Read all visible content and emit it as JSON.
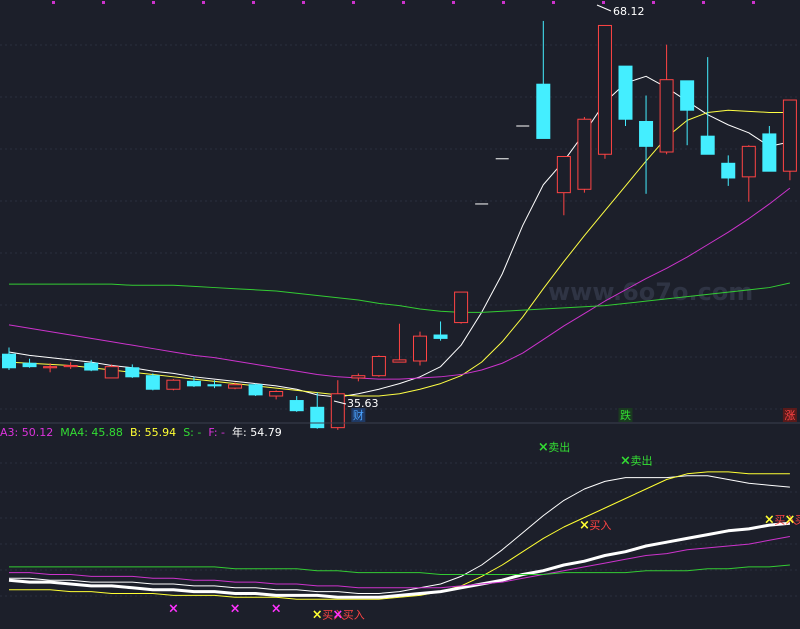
{
  "chart_data": [
    {
      "type": "candlestick",
      "panel": "price",
      "grid": true,
      "ylim": [
        33,
        70
      ],
      "annotations": {
        "high_label": "68.12",
        "low_label": "35.63",
        "watermark": "www.6o7o.com"
      },
      "markers": [
        {
          "x": 17,
          "label": "财",
          "color": "#4aa3ff",
          "bg": "#1f3a66"
        },
        {
          "x": 30,
          "label": "跌",
          "color": "#33dd33",
          "bg": "#1a3a20"
        },
        {
          "x": 38,
          "label": "涨",
          "color": "#ff4444",
          "bg": "#5a1a1a"
        }
      ],
      "candles": [
        {
          "o": 39.0,
          "h": 39.6,
          "l": 37.6,
          "c": 37.8
        },
        {
          "o": 38.2,
          "h": 38.6,
          "l": 37.8,
          "c": 37.9
        },
        {
          "o": 37.8,
          "h": 38.2,
          "l": 37.4,
          "c": 37.9
        },
        {
          "o": 37.9,
          "h": 38.3,
          "l": 37.7,
          "c": 38.0
        },
        {
          "o": 38.2,
          "h": 38.5,
          "l": 37.5,
          "c": 37.6
        },
        {
          "o": 36.9,
          "h": 38.1,
          "l": 36.9,
          "c": 37.9
        },
        {
          "o": 37.8,
          "h": 38.1,
          "l": 36.9,
          "c": 37.0
        },
        {
          "o": 37.1,
          "h": 37.3,
          "l": 35.8,
          "c": 35.9
        },
        {
          "o": 35.9,
          "h": 36.8,
          "l": 35.8,
          "c": 36.7
        },
        {
          "o": 36.6,
          "h": 37.0,
          "l": 36.1,
          "c": 36.2
        },
        {
          "o": 36.3,
          "h": 36.7,
          "l": 36.0,
          "c": 36.2
        },
        {
          "o": 36.0,
          "h": 36.5,
          "l": 35.9,
          "c": 36.3
        },
        {
          "o": 36.3,
          "h": 36.4,
          "l": 35.3,
          "c": 35.4
        },
        {
          "o": 35.3,
          "h": 35.8,
          "l": 35.0,
          "c": 35.7
        },
        {
          "o": 34.9,
          "h": 35.3,
          "l": 33.9,
          "c": 34.0
        },
        {
          "o": 34.3,
          "h": 35.6,
          "l": 32.4,
          "c": 32.5
        },
        {
          "o": 32.5,
          "h": 36.7,
          "l": 32.3,
          "c": 35.5
        },
        {
          "o": 36.9,
          "h": 37.3,
          "l": 36.6,
          "c": 37.1
        },
        {
          "o": 37.1,
          "h": 38.9,
          "l": 37.0,
          "c": 38.8
        },
        {
          "o": 38.3,
          "h": 41.7,
          "l": 38.3,
          "c": 38.5
        },
        {
          "o": 38.4,
          "h": 41.0,
          "l": 38.0,
          "c": 40.6
        },
        {
          "o": 40.7,
          "h": 41.9,
          "l": 40.2,
          "c": 40.4
        },
        {
          "o": 41.8,
          "h": 44.5,
          "l": 41.7,
          "c": 44.5
        },
        {
          "o": 52.3,
          "h": 52.3,
          "l": 52.3,
          "c": 52.3
        },
        {
          "o": 56.3,
          "h": 56.3,
          "l": 56.3,
          "c": 56.3
        },
        {
          "o": 59.2,
          "h": 59.2,
          "l": 59.2,
          "c": 59.2
        },
        {
          "o": 62.9,
          "h": 68.5,
          "l": 60.8,
          "c": 58.1
        },
        {
          "o": 53.3,
          "h": 56.1,
          "l": 51.3,
          "c": 56.5
        },
        {
          "o": 53.6,
          "h": 60.0,
          "l": 53.3,
          "c": 59.8
        },
        {
          "o": 56.7,
          "h": 62.2,
          "l": 56.3,
          "c": 68.1
        },
        {
          "o": 64.5,
          "h": 64.5,
          "l": 59.2,
          "c": 59.8
        },
        {
          "o": 59.6,
          "h": 61.9,
          "l": 53.2,
          "c": 57.4
        },
        {
          "o": 56.9,
          "h": 66.4,
          "l": 56.7,
          "c": 63.3
        },
        {
          "o": 63.2,
          "h": 63.2,
          "l": 57.5,
          "c": 60.6
        },
        {
          "o": 58.3,
          "h": 65.3,
          "l": 58.1,
          "c": 56.7
        },
        {
          "o": 55.9,
          "h": 56.6,
          "l": 53.9,
          "c": 54.6
        },
        {
          "o": 54.7,
          "h": 57.5,
          "l": 52.5,
          "c": 57.4
        },
        {
          "o": 58.5,
          "h": 59.2,
          "l": 55.2,
          "c": 55.2
        },
        {
          "o": 55.2,
          "h": 56.3,
          "l": 54.4,
          "c": 61.5
        }
      ],
      "series": [
        {
          "color": "#ffffff",
          "values": [
            39.2,
            38.9,
            38.7,
            38.5,
            38.3,
            38.0,
            37.8,
            37.5,
            37.3,
            37.0,
            36.8,
            36.6,
            36.4,
            36.2,
            35.9,
            35.4,
            35.2,
            35.5,
            35.9,
            36.4,
            37.0,
            37.9,
            39.8,
            42.7,
            46.1,
            50.4,
            54.0,
            56.1,
            58.6,
            61.3,
            63.0,
            63.6,
            62.6,
            61.4,
            60.2,
            59.3,
            58.6,
            57.4,
            57.8
          ]
        },
        {
          "color": "#ffff44",
          "values": [
            38.3,
            38.2,
            38.1,
            38.0,
            37.8,
            37.6,
            37.4,
            37.2,
            37.0,
            36.8,
            36.6,
            36.4,
            36.2,
            36.0,
            35.8,
            35.6,
            35.4,
            35.3,
            35.3,
            35.5,
            35.9,
            36.4,
            37.1,
            38.3,
            40.1,
            42.3,
            44.8,
            47.2,
            49.5,
            51.7,
            53.9,
            56.1,
            58.2,
            59.7,
            60.4,
            60.6,
            60.5,
            60.4,
            60.4
          ]
        },
        {
          "color": "#cc33cc",
          "values": [
            41.6,
            41.3,
            41.0,
            40.7,
            40.4,
            40.1,
            39.8,
            39.5,
            39.2,
            38.9,
            38.7,
            38.4,
            38.1,
            37.8,
            37.5,
            37.2,
            37.0,
            36.9,
            36.8,
            36.8,
            36.9,
            37.0,
            37.2,
            37.6,
            38.2,
            39.1,
            40.3,
            41.5,
            42.6,
            43.7,
            44.7,
            45.7,
            46.6,
            47.6,
            48.7,
            49.8,
            51.0,
            52.3,
            53.7
          ]
        },
        {
          "color": "#33cc33",
          "values": [
            45.2,
            45.2,
            45.2,
            45.2,
            45.2,
            45.2,
            45.1,
            45.1,
            45.1,
            45.0,
            44.9,
            44.8,
            44.7,
            44.6,
            44.4,
            44.2,
            44.0,
            43.8,
            43.5,
            43.3,
            43.0,
            42.8,
            42.7,
            42.7,
            42.8,
            42.9,
            43.0,
            43.1,
            43.2,
            43.3,
            43.5,
            43.7,
            43.9,
            44.1,
            44.3,
            44.5,
            44.7,
            44.9,
            45.3
          ]
        }
      ]
    },
    {
      "type": "line",
      "panel": "indicator",
      "ylim": [
        0,
        100
      ],
      "legend": [
        {
          "text": "A3: 50.12",
          "color": "#dd33dd"
        },
        {
          "text": "MA4: 45.88",
          "color": "#33dd33"
        },
        {
          "text": "B: 55.94",
          "color": "#ffff33"
        },
        {
          "text": "S: -",
          "color": "#33dd33"
        },
        {
          "text": "F: -",
          "color": "#dd33dd"
        },
        {
          "text": "年: 54.79",
          "color": "#ffffff"
        }
      ],
      "series": [
        {
          "color": "#ffffff",
          "width": 1,
          "values": [
            23,
            23,
            22,
            22,
            21,
            21,
            21,
            20,
            20,
            19,
            19,
            18,
            18,
            17,
            17,
            16,
            16,
            15,
            15,
            16,
            18,
            20,
            24,
            30,
            38,
            47,
            56,
            64,
            70,
            74,
            76,
            76,
            76,
            77,
            77,
            75,
            73,
            72,
            71
          ]
        },
        {
          "color": "#ffff33",
          "width": 1,
          "values": [
            17,
            17,
            17,
            16,
            16,
            15,
            15,
            15,
            14,
            14,
            14,
            13,
            13,
            13,
            12,
            12,
            12,
            12,
            12,
            13,
            14,
            16,
            19,
            24,
            30,
            37,
            44,
            50,
            55,
            60,
            65,
            70,
            75,
            78,
            79,
            79,
            78,
            78,
            78
          ]
        },
        {
          "color": "#ffffff",
          "width": 3,
          "values": [
            22,
            21,
            21,
            20,
            19,
            19,
            18,
            17,
            17,
            16,
            16,
            15,
            15,
            14,
            14,
            14,
            13,
            13,
            13,
            14,
            15,
            16,
            18,
            20,
            22,
            25,
            27,
            30,
            32,
            35,
            37,
            40,
            42,
            44,
            46,
            48,
            49,
            51,
            52
          ]
        },
        {
          "color": "#cc33cc",
          "width": 1,
          "values": [
            26,
            26,
            25,
            25,
            24,
            24,
            24,
            23,
            23,
            22,
            22,
            21,
            21,
            20,
            20,
            19,
            19,
            18,
            18,
            18,
            18,
            18,
            19,
            20,
            21,
            23,
            25,
            27,
            29,
            31,
            33,
            35,
            36,
            38,
            39,
            40,
            41,
            43,
            45
          ]
        },
        {
          "color": "#33cc33",
          "width": 1,
          "values": [
            29,
            29,
            29,
            29,
            29,
            29,
            29,
            29,
            29,
            29,
            29,
            28,
            28,
            28,
            28,
            27,
            27,
            26,
            26,
            26,
            26,
            25,
            25,
            25,
            25,
            25,
            25,
            26,
            26,
            26,
            26,
            27,
            27,
            27,
            28,
            28,
            29,
            29,
            30
          ]
        }
      ],
      "signals": [
        {
          "x": 8,
          "y": 7,
          "mark": "×",
          "color": "#ff33ff",
          "text": ""
        },
        {
          "x": 11,
          "y": 7,
          "mark": "×",
          "color": "#ff33ff",
          "text": ""
        },
        {
          "x": 13,
          "y": 7,
          "mark": "×",
          "color": "#ff33ff",
          "text": ""
        },
        {
          "x": 15,
          "y": 4,
          "mark": "×",
          "color": "#ffff33",
          "text": "买入"
        },
        {
          "x": 16,
          "y": 4,
          "mark": "×",
          "color": "#ff33ff",
          "text": "买入"
        },
        {
          "x": 26,
          "y": 92,
          "mark": "×",
          "color": "#33dd33",
          "text": "卖出"
        },
        {
          "x": 30,
          "y": 85,
          "mark": "×",
          "color": "#33dd33",
          "text": "卖出"
        },
        {
          "x": 28,
          "y": 51,
          "mark": "×",
          "color": "#ffff33",
          "text": "买入"
        },
        {
          "x": 37,
          "y": 54,
          "mark": "×",
          "color": "#ffff33",
          "text": "买入"
        },
        {
          "x": 38,
          "y": 54,
          "mark": "×",
          "color": "#ffff33",
          "text": "买入"
        }
      ]
    }
  ]
}
